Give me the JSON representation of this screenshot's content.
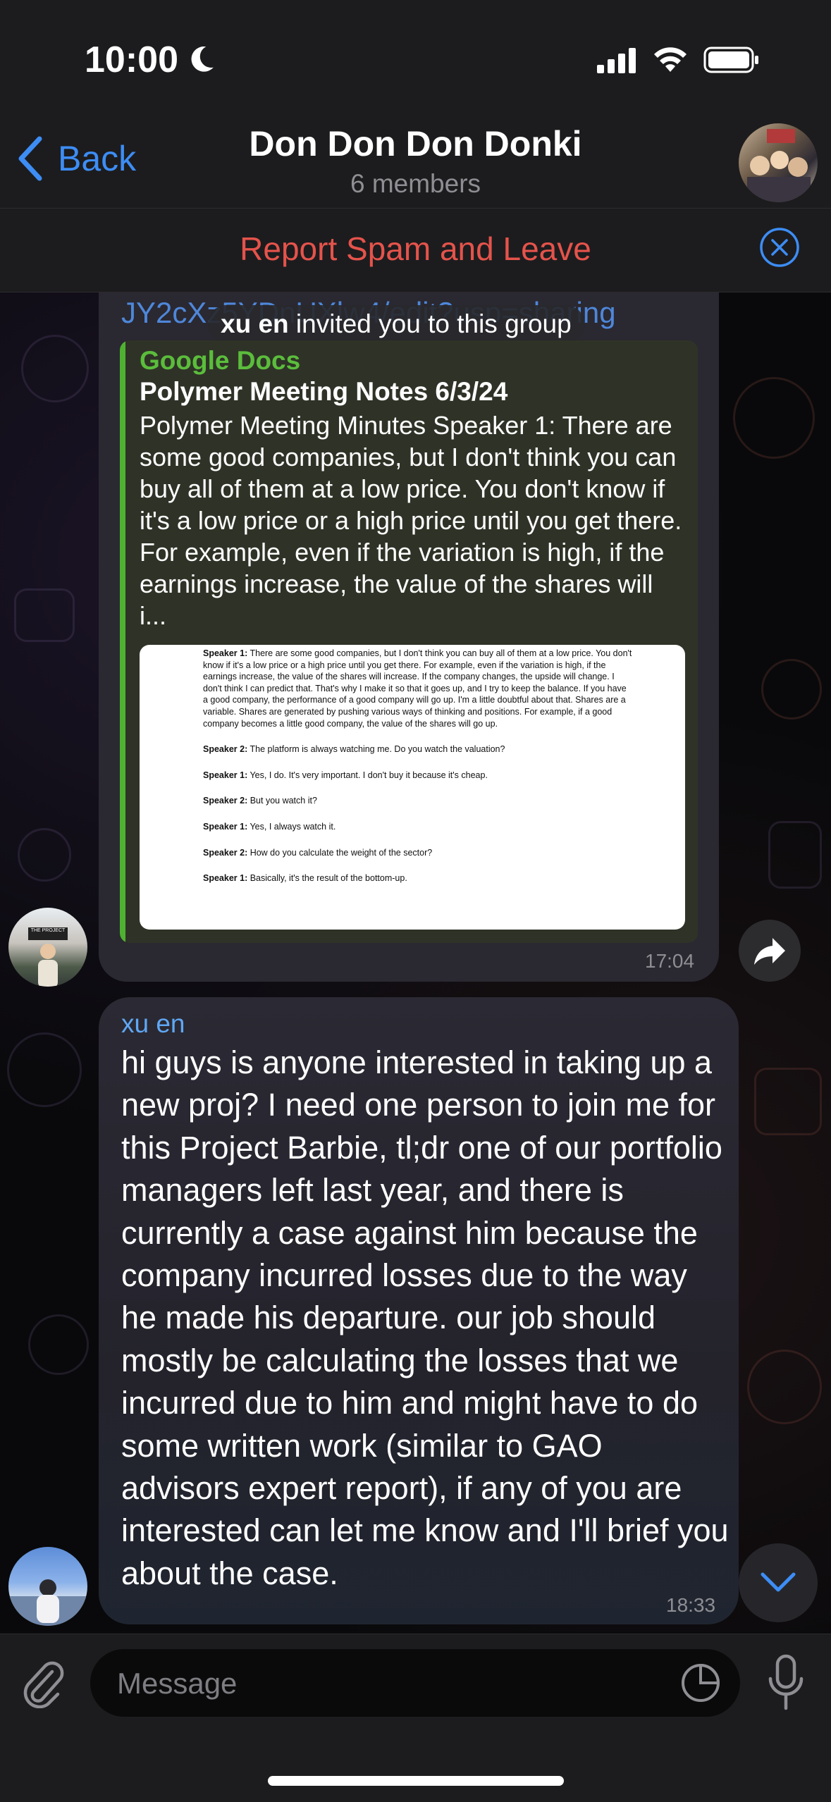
{
  "status_bar": {
    "time": "10:00"
  },
  "header": {
    "back_label": "Back",
    "title": "Don Don Don Donki",
    "members": "6 members"
  },
  "report_bar": {
    "label": "Report Spam and Leave"
  },
  "messages": [
    {
      "link_fragment": "JY2cXz5YDnUXlw4/edit?usp=sharing",
      "service": {
        "name": "xu en",
        "text": " invited you to this group"
      },
      "preview": {
        "site": "Google Docs",
        "title": "Polymer Meeting Notes 6/3/24",
        "description": "Polymer Meeting Minutes  Speaker 1: There are some good companies, but I don't think you can buy all of them at a low price. You don't know if it's a low price or a high price until you get there. For example, even if the variation is high, if the earnings increase, the value of the shares will i...",
        "doc_lines": [
          {
            "speaker": "Speaker 1:",
            "text": " There are some good companies, but I don't think you can buy all of them at a low price. You don't know if it's a low price or a high price until you get there. For example, even if the variation is high, if the earnings increase, the value of the shares will increase. If the company changes, the upside will change. I don't think I can predict that. That's why I make it so that it goes up, and I try to keep the balance. If you have a good company, the performance of a good company will go up. I'm a little doubtful about that. Shares are a variable. Shares are generated by pushing various ways of thinking and positions. For example, if a good company becomes a little good company, the value of the shares will go up."
          },
          {
            "speaker": "Speaker 2:",
            "text": " The platform is always watching me. Do you watch the valuation?"
          },
          {
            "speaker": "Speaker 1:",
            "text": " Yes, I do. It's very important. I don't buy it because it's cheap."
          },
          {
            "speaker": "Speaker 2:",
            "text": " But you watch it?"
          },
          {
            "speaker": "Speaker 1:",
            "text": " Yes, I always watch it."
          },
          {
            "speaker": "Speaker 2:",
            "text": " How do you calculate the weight of the sector?"
          },
          {
            "speaker": "Speaker 1:",
            "text": " Basically, it's the result of the bottom-up."
          }
        ]
      },
      "time": "17:04",
      "avatar_sign": "THE PROJECT"
    },
    {
      "sender": "xu en",
      "text": "hi guys is anyone interested in taking up a new proj? I need one person to join me for this Project Barbie, tl;dr one of our portfolio managers left last year, and there is currently a case against him because the company incurred losses due to the way he made his departure. our job should mostly be calculating the losses that we incurred due to him and might have to do some written work (similar to GAO advisors expert report), if any of you are interested can let me know and I'll brief you about the case.",
      "time": "18:33"
    }
  ],
  "input": {
    "placeholder": "Message"
  },
  "colors": {
    "accent": "#3d8df5",
    "report": "#e5534b",
    "link_bar": "#4fb131",
    "sender": "#5fa7f5"
  }
}
